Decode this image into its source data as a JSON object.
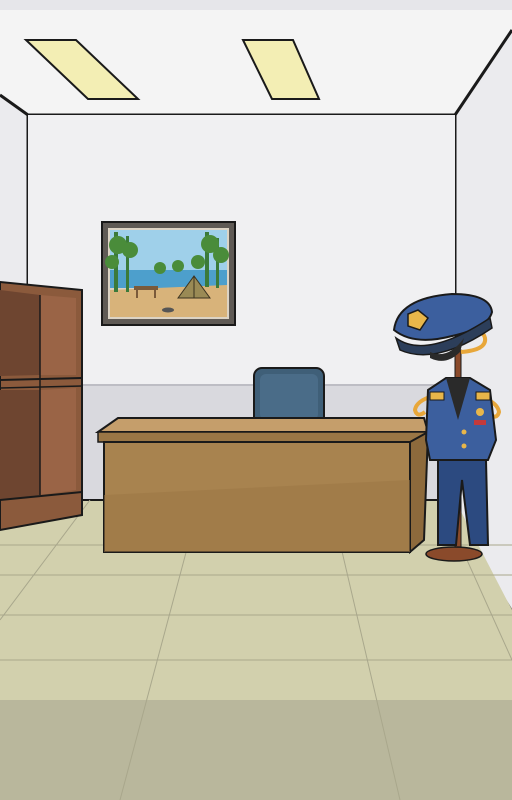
{
  "scene": {
    "name": "police-office",
    "colors": {
      "ceiling": "#f4f4f4",
      "ceiling_shadow": "#d8d8dc",
      "back_wall": "#f0f0f2",
      "side_wall": "#ebebee",
      "wainscot": "#d9d9de",
      "floor": "#d2d0ad",
      "floor_light": "#dcdab8",
      "floor_shadow": "#b8b69a",
      "outline": "#1a1a1a",
      "light_panel": "#f3eeb4",
      "desk_top": "#b58f5f",
      "desk_front": "#a8834f",
      "desk_shadow": "#8d6a3c",
      "shelf": "#8b5a3c",
      "shelf_inner": "#6e4530",
      "chair": "#3f5f78",
      "uniform": "#3c5f9e",
      "uniform_dark": "#2c4a80",
      "badge_gold": "#e8b64a",
      "stand": "#8a4a2b"
    },
    "objects": [
      {
        "id": "ceiling-light-left",
        "icon": "ceiling-light-icon"
      },
      {
        "id": "ceiling-light-right",
        "icon": "ceiling-light-icon"
      },
      {
        "id": "framed-painting",
        "icon": "camping-painting-icon"
      },
      {
        "id": "bookshelf",
        "icon": "bookshelf-icon"
      },
      {
        "id": "office-chair",
        "icon": "chair-icon"
      },
      {
        "id": "office-desk",
        "icon": "desk-icon"
      },
      {
        "id": "police-uniform-stand",
        "icon": "police-uniform-icon"
      }
    ]
  }
}
